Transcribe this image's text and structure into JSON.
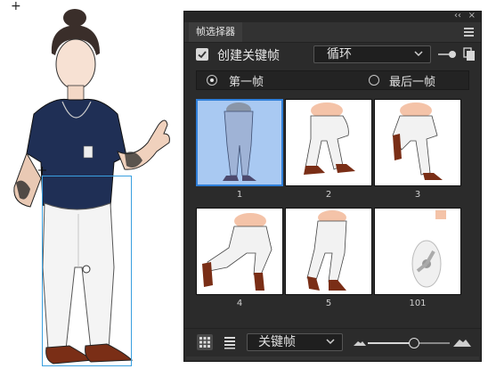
{
  "canvas": {
    "cursor_symbol": "+"
  },
  "panel": {
    "collapse_symbol": "‹‹",
    "close_symbol": "×",
    "title": "帧选择器",
    "create_keyframe_label": "创建关键帧",
    "create_keyframe_checked": true,
    "loop_dropdown_value": "循环",
    "first_frame_label": "第一帧",
    "last_frame_label": "最后一帧",
    "selected_radio": "first",
    "frames": [
      {
        "number": "1",
        "selected": true
      },
      {
        "number": "2",
        "selected": false
      },
      {
        "number": "3",
        "selected": false
      },
      {
        "number": "4",
        "selected": false
      },
      {
        "number": "5",
        "selected": false
      },
      {
        "number": "101",
        "selected": false
      }
    ],
    "filter_dropdown_value": "关键帧",
    "thumbnail_size_fraction": 0.55,
    "colors": {
      "panel_bg": "#2b2b2b",
      "selected_frame": "#a9c9f2",
      "selected_border": "#2f7fd9",
      "selection_box": "#3aa0e0"
    }
  }
}
